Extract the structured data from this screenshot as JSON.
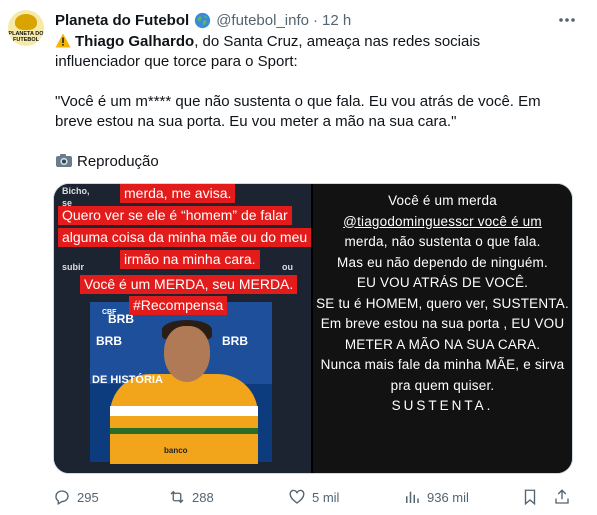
{
  "account": {
    "name": "Planeta do Futebol",
    "handle": "@futebol_info",
    "separator": "·",
    "time": "12 h",
    "avatar_text": "PLANETA DO FUTEBOL"
  },
  "tweet": {
    "bold_name": "Thiago Galhardo",
    "line1_rest": ", do Santa Cruz, ameaça nas redes sociais",
    "line2": "influenciador que torce para o Sport:",
    "quote": "\"Você é um m**** que não sustenta o que fala. Eu vou atrás de você. Em breve estou na sua porta. Eu vou meter a mão na sua cara.\"",
    "credit": "Reprodução"
  },
  "media_left": {
    "bg_words": [
      "Bicho,",
      "se",
      "subir",
      "ou"
    ],
    "captions": [
      "merda, me avisa.",
      "Quero ver se ele é “homem” de falar",
      "alguma coisa da minha mãe ou do meu",
      "irmão na minha cara.",
      "Você é um MERDA, seu MERDA.",
      "#Recompensa"
    ],
    "sponsors": [
      "BRB",
      "BRB",
      "BRB",
      "DE HISTÓRIA",
      "CBF",
      "banco"
    ]
  },
  "media_right": {
    "lines": [
      "Você é um merda",
      "@tiagodominguesscr você é um",
      "merda, não sustenta o que fala.",
      "Mas eu não dependo de ninguém.",
      "EU VOU ATRÁS DE VOCÊ.",
      "SE tu é HOMEM, quero ver, SUSTENTA.",
      "Em breve estou na sua porta , EU VOU",
      "METER A MÃO NA SUA CARA.",
      "Nunca mais fale da minha MÃE, e sirva",
      "pra quem quiser.",
      "SUSTENTA."
    ]
  },
  "actions": {
    "replies": "295",
    "reposts": "288",
    "likes": "5 mil",
    "views": "936 mil"
  },
  "colors": {
    "text": "#0f1419",
    "secondary": "#536471",
    "caption_red": "#e31b1b"
  },
  "icons": [
    "globe-icon",
    "more-icon",
    "warning-icon",
    "camera-icon",
    "reply-icon",
    "repost-icon",
    "like-icon",
    "views-icon",
    "bookmark-icon",
    "share-icon"
  ]
}
